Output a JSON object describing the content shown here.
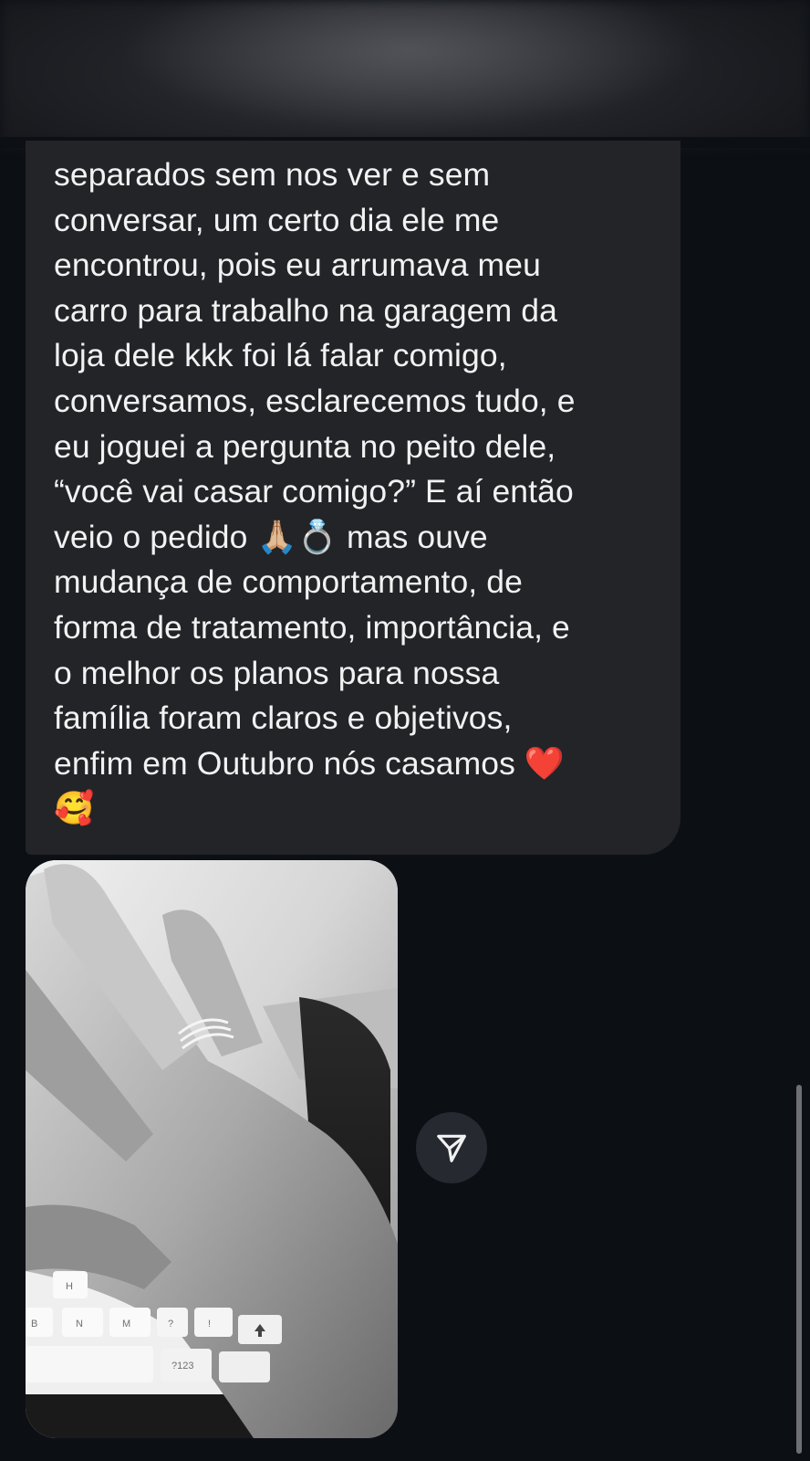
{
  "header": {
    "state": "blurred"
  },
  "message": {
    "lines": [
      "separados sem nos ver e sem",
      "conversar, um certo dia ele me",
      "encontrou, pois eu arrumava meu",
      "carro para trabalho na garagem da",
      "loja dele kkk foi lá falar comigo,",
      "conversamos, esclarecemos tudo, e",
      "eu joguei a pergunta no peito dele,",
      "“você vai casar comigo?” E aí então",
      "veio o pedido ",
      "mudança de comportamento, de",
      "forma de tratamento, importância, e",
      "o melhor os planos para nossa",
      "família foram claros e objetivos,",
      "enfim em Outubro nós casamos "
    ],
    "line9_after_emoji": " mas ouve",
    "emoji_pray": "🙏🏼",
    "emoji_ring": "💍",
    "emoji_heart": "❤️",
    "emoji_smile": "🥰",
    "bubble_color": "#222428",
    "text_color": "#f2f2f2"
  },
  "photo": {
    "subject": "hand-with-ring",
    "keyboard_keys": [
      "H",
      "B",
      "N",
      "M",
      "?",
      "!",
      "?123"
    ]
  },
  "share_button": {
    "icon": "send-icon"
  },
  "colors": {
    "background": "#0c0f14",
    "share_button_bg": "#262a30",
    "scrollbar": "#6d6f74"
  }
}
